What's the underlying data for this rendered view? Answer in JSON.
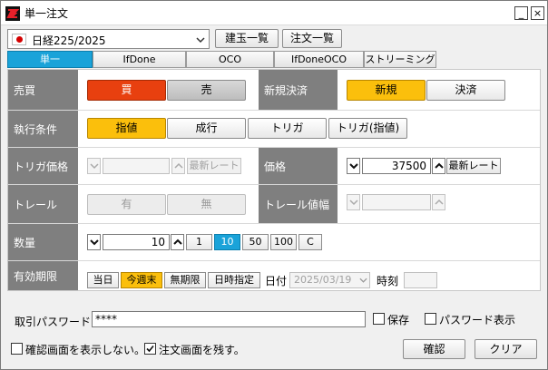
{
  "window": {
    "title": "単一注文",
    "minimize": "_",
    "close": "×"
  },
  "toolbar": {
    "symbol": "日経225/2025",
    "positions_button": "建玉一覧",
    "orders_button": "注文一覧"
  },
  "tabs": [
    {
      "label": "単一",
      "active": true
    },
    {
      "label": "IfDone",
      "active": false
    },
    {
      "label": "OCO",
      "active": false
    },
    {
      "label": "IfDoneOCO",
      "active": false
    },
    {
      "label": "ストリーミング",
      "active": false
    }
  ],
  "form": {
    "side_label": "売買",
    "buy": "買",
    "sell": "売",
    "newclose_label": "新規決済",
    "new": "新規",
    "close": "決済",
    "exec_label": "執行条件",
    "exec_options": [
      "指値",
      "成行",
      "トリガ",
      "トリガ(指値)"
    ],
    "trigger_price_label": "トリガ価格",
    "trigger_latest": "最新レート",
    "price_label": "価格",
    "price_value": "37500",
    "price_latest": "最新レート",
    "trail_label": "トレール",
    "trail_on": "有",
    "trail_off": "無",
    "trail_width_label": "トレール値幅",
    "qty_label": "数量",
    "qty_value": "10",
    "qty_presets": [
      "1",
      "10",
      "50",
      "100",
      "C"
    ],
    "expiry_label": "有効期限",
    "expiry_options": [
      "当日",
      "今週末",
      "無期限",
      "日時指定"
    ],
    "date_label": "日付",
    "date_value": "2025/03/19",
    "time_label": "時刻"
  },
  "footer": {
    "password_label": "取引パスワード",
    "password_value": "****",
    "save_label": "保存",
    "show_password_label": "パスワード表示",
    "no_confirm_label": "確認画面を表示しない。",
    "keep_window_label": "注文画面を残す。",
    "confirm_button": "確認",
    "clear_button": "クリア"
  },
  "colors": {
    "buy_active": "#e8400f",
    "gold_active": "#fbbf0c",
    "tab_active": "#1aa3d9",
    "label_bg": "#7f7f7f"
  },
  "icons": [
    "app-logo-icon",
    "japan-flag-icon",
    "chevron-down-icon",
    "chevron-up-icon",
    "checkmark-icon"
  ]
}
